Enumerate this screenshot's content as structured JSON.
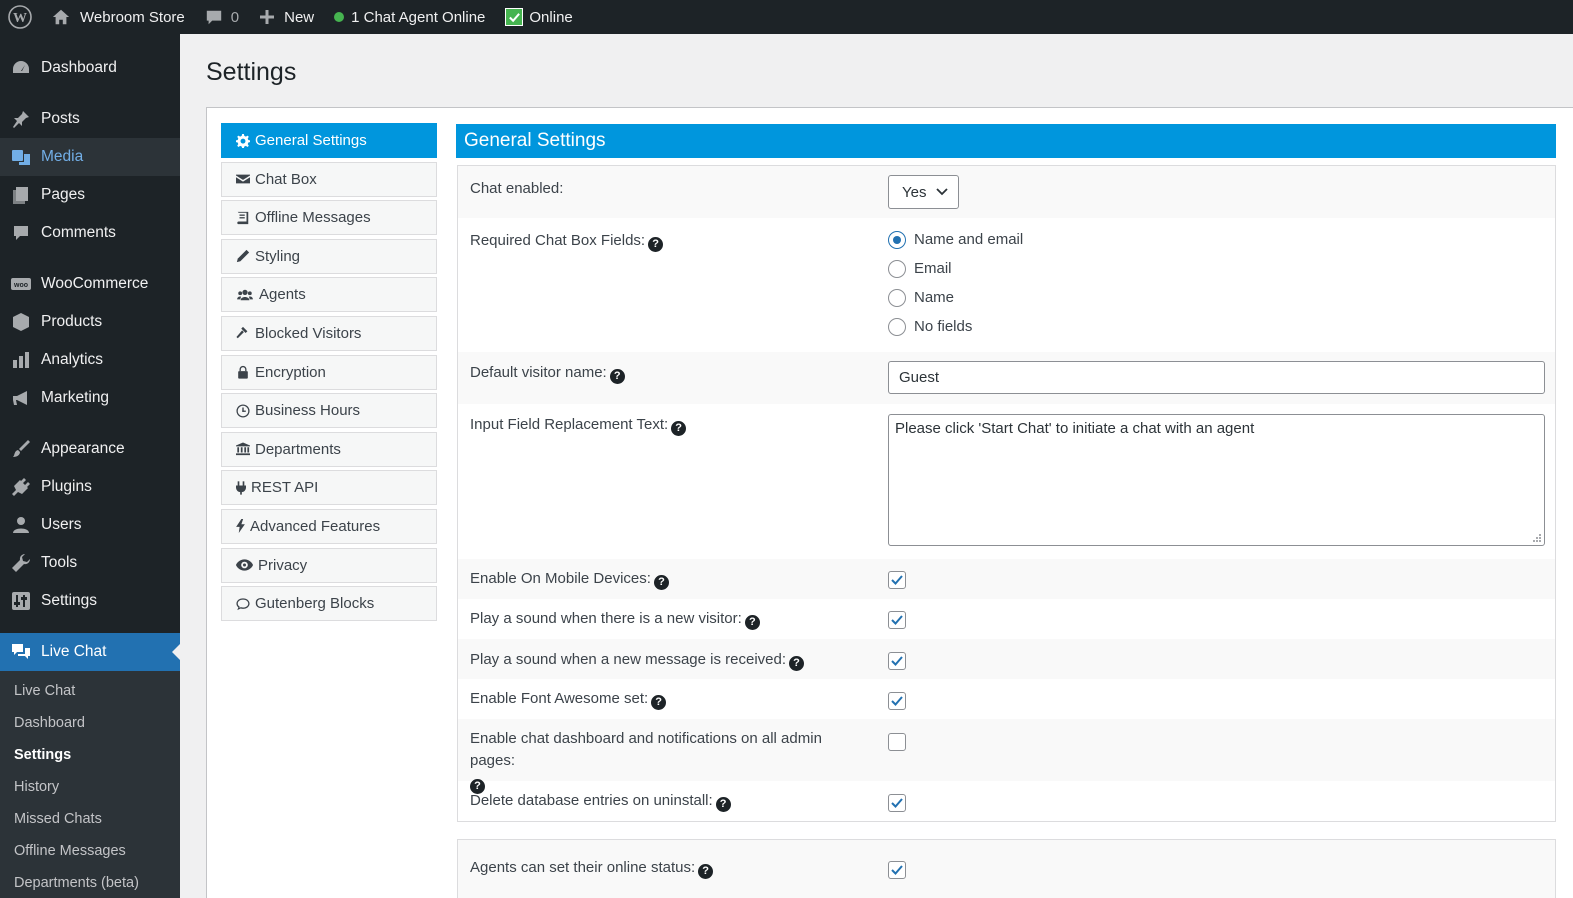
{
  "adminbar": {
    "site_name": "Webroom Store",
    "comments_count": "0",
    "new_label": "New",
    "agents_online": "1 Chat Agent Online",
    "status_label": "Online"
  },
  "sidebar": {
    "items": [
      {
        "label": "Dashboard",
        "icon": "dashboard-icon"
      },
      {
        "label": "Posts",
        "icon": "pin-icon"
      },
      {
        "label": "Media",
        "icon": "media-icon"
      },
      {
        "label": "Pages",
        "icon": "pages-icon"
      },
      {
        "label": "Comments",
        "icon": "comments-icon"
      },
      {
        "label": "WooCommerce",
        "icon": "woo-icon"
      },
      {
        "label": "Products",
        "icon": "box-icon"
      },
      {
        "label": "Analytics",
        "icon": "bar-chart-icon"
      },
      {
        "label": "Marketing",
        "icon": "megaphone-icon"
      },
      {
        "label": "Appearance",
        "icon": "brush-icon"
      },
      {
        "label": "Plugins",
        "icon": "plug-icon"
      },
      {
        "label": "Users",
        "icon": "user-icon"
      },
      {
        "label": "Tools",
        "icon": "wrench-icon"
      },
      {
        "label": "Settings",
        "icon": "sliders-icon"
      },
      {
        "label": "Live Chat",
        "icon": "chat-bubbles-icon"
      }
    ],
    "submenu": [
      "Live Chat",
      "Dashboard",
      "Settings",
      "History",
      "Missed Chats",
      "Offline Messages",
      "Departments (beta)"
    ]
  },
  "page": {
    "title": "Settings"
  },
  "tabs": [
    {
      "label": "General Settings",
      "icon": "gear-icon"
    },
    {
      "label": "Chat Box",
      "icon": "envelope-icon"
    },
    {
      "label": "Offline Messages",
      "icon": "book-icon"
    },
    {
      "label": "Styling",
      "icon": "pencil-icon"
    },
    {
      "label": "Agents",
      "icon": "users-icon"
    },
    {
      "label": "Blocked Visitors",
      "icon": "gavel-icon"
    },
    {
      "label": "Encryption",
      "icon": "lock-icon"
    },
    {
      "label": "Business Hours",
      "icon": "clock-icon"
    },
    {
      "label": "Departments",
      "icon": "bank-icon"
    },
    {
      "label": "REST API",
      "icon": "plug-icon"
    },
    {
      "label": "Advanced Features",
      "icon": "bolt-icon"
    },
    {
      "label": "Privacy",
      "icon": "eye-icon"
    },
    {
      "label": "Gutenberg Blocks",
      "icon": "comment-icon"
    }
  ],
  "general": {
    "header": "General Settings",
    "chat_enabled_label": "Chat enabled:",
    "chat_enabled_value": "Yes",
    "required_fields_label": "Required Chat Box Fields:",
    "required_fields_options": [
      "Name and email",
      "Email",
      "Name",
      "No fields"
    ],
    "required_fields_selected": "Name and email",
    "default_name_label": "Default visitor name:",
    "default_name_value": "Guest",
    "replacement_label": "Input Field Replacement Text:",
    "replacement_value": "Please click 'Start Chat' to initiate a chat with an agent",
    "mobile_label": "Enable On Mobile Devices:",
    "mobile_checked": true,
    "sound_visitor_label": "Play a sound when there is a new visitor:",
    "sound_visitor_checked": true,
    "sound_message_label": "Play a sound when a new message is received:",
    "sound_message_checked": true,
    "font_awesome_label": "Enable Font Awesome set:",
    "font_awesome_checked": true,
    "dashboard_all_label": "Enable chat dashboard and notifications on all admin pages:",
    "dashboard_all_checked": false,
    "delete_db_label": "Delete database entries on uninstall:",
    "delete_db_checked": true,
    "online_status_label": "Agents can set their online status:",
    "online_status_checked": true
  },
  "colors": {
    "accent": "#0096dd",
    "wp_blue": "#2271b1",
    "sidebar_bg": "#1d2327"
  }
}
